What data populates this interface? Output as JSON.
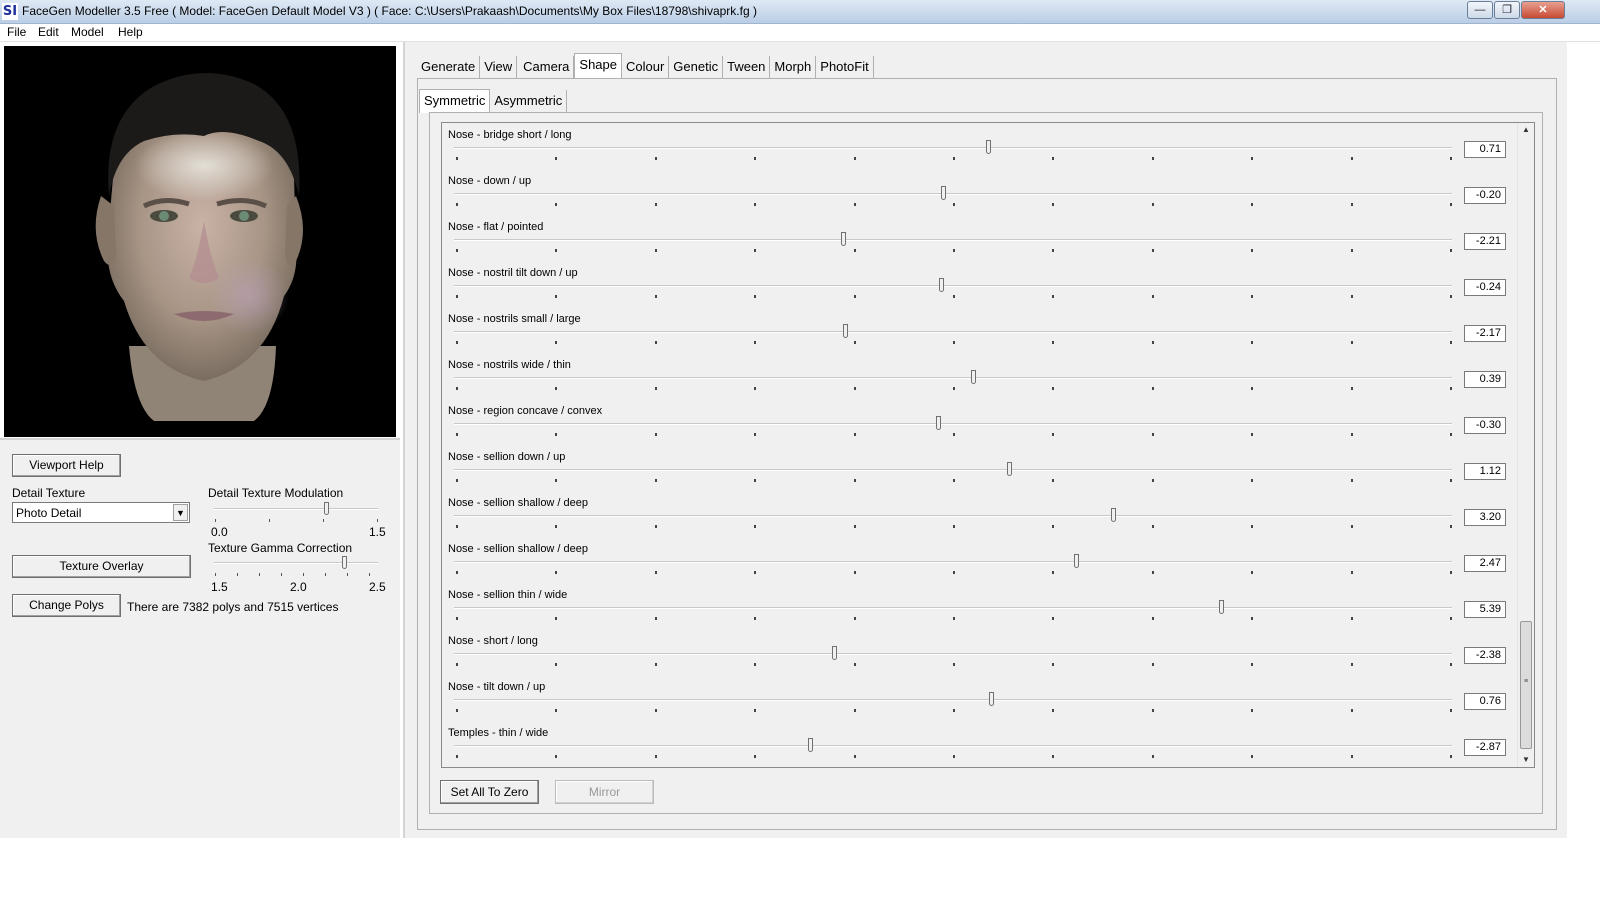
{
  "window": {
    "app_icon": "SI",
    "title": "FaceGen Modeller 3.5 Free  ( Model: FaceGen Default Model V3 )  ( Face: C:\\Users\\Prakaash\\Documents\\My Box Files\\18798\\shivaprk.fg )",
    "controls": {
      "minimize": "—",
      "maximize": "❐",
      "close": "✕"
    }
  },
  "menu": {
    "items": [
      "File",
      "Edit",
      "Model",
      "Help"
    ]
  },
  "left": {
    "viewport_help": "Viewport Help",
    "detail_texture_label": "Detail Texture",
    "detail_texture_value": "Photo Detail",
    "modulation_label": "Detail Texture Modulation",
    "modulation_min": "0.0",
    "modulation_max": "1.5",
    "modulation_level": 0.68,
    "gamma_label": "Texture Gamma Correction",
    "gamma_min": "1.5",
    "gamma_mid": "2.0",
    "gamma_max": "2.5",
    "gamma_level": 0.79,
    "texture_overlay": "Texture Overlay",
    "change_polys": "Change Polys",
    "poly_info": "There are 7382 polys and 7515 vertices"
  },
  "tabs": [
    "Generate",
    "View",
    "Camera",
    "Shape",
    "Colour",
    "Genetic",
    "Tween",
    "Morph",
    "PhotoFit"
  ],
  "active_tab": "Shape",
  "subtabs": [
    "Symmetric",
    "Asymmetric"
  ],
  "active_subtab": "Symmetric",
  "sliders": [
    {
      "label": "Nose - bridge short / long",
      "value": "0.71",
      "level": 0.535
    },
    {
      "label": "Nose - down / up",
      "value": "-0.20",
      "level": 0.49
    },
    {
      "label": "Nose - flat / pointed",
      "value": "-2.21",
      "level": 0.39
    },
    {
      "label": "Nose - nostril tilt down / up",
      "value": "-0.24",
      "level": 0.488
    },
    {
      "label": "Nose - nostrils small / large",
      "value": "-2.17",
      "level": 0.392
    },
    {
      "label": "Nose - nostrils wide / thin",
      "value": "0.39",
      "level": 0.52
    },
    {
      "label": "Nose - region concave / convex",
      "value": "-0.30",
      "level": 0.485
    },
    {
      "label": "Nose - sellion down / up",
      "value": "1.12",
      "level": 0.556
    },
    {
      "label": "Nose - sellion shallow / deep",
      "value": "3.20",
      "level": 0.66
    },
    {
      "label": "Nose - sellion shallow / deep",
      "value": "2.47",
      "level": 0.623
    },
    {
      "label": "Nose - sellion thin / wide",
      "value": "5.39",
      "level": 0.769
    },
    {
      "label": "Nose - short / long",
      "value": "-2.38",
      "level": 0.381
    },
    {
      "label": "Nose - tilt down / up",
      "value": "0.76",
      "level": 0.538
    },
    {
      "label": "Temples - thin / wide",
      "value": "-2.87",
      "level": 0.357
    }
  ],
  "bottom": {
    "set_all_zero": "Set All To Zero",
    "mirror": "Mirror"
  }
}
